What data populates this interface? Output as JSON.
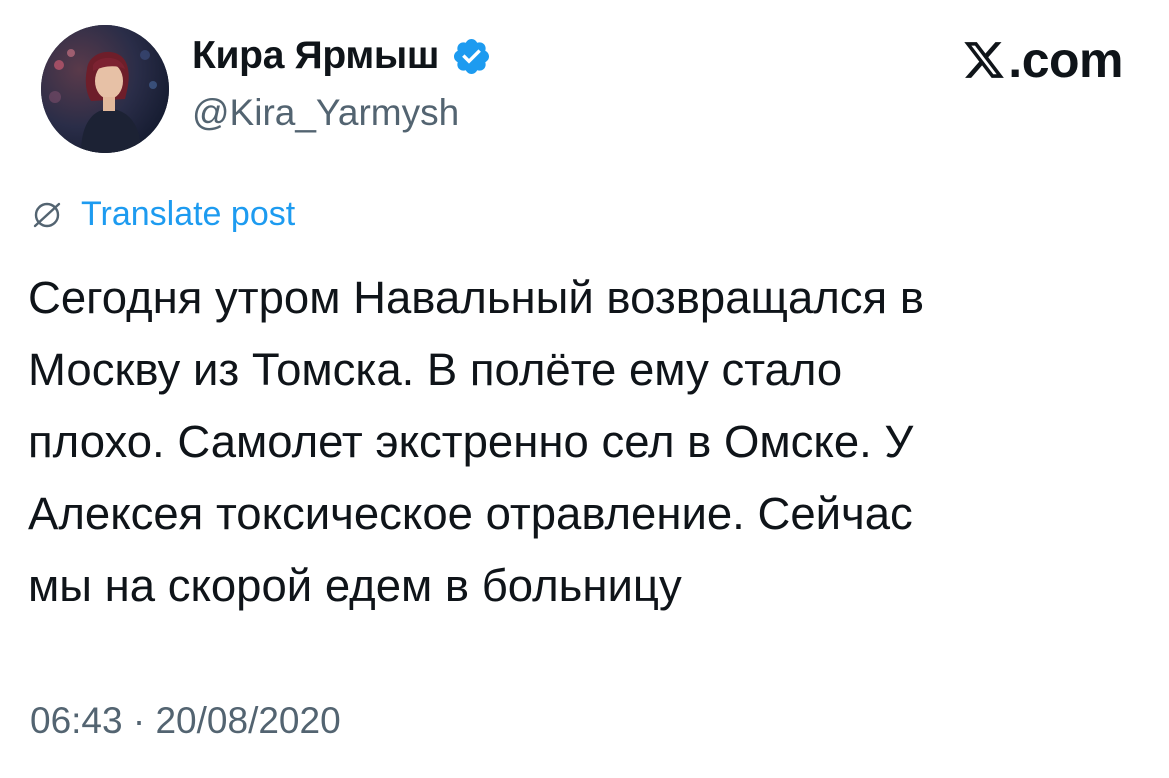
{
  "brand": {
    "text": ".com",
    "icon": "x-logo-icon"
  },
  "author": {
    "display_name": "Кира Ярмыш",
    "handle": "@Kira_Yarmysh",
    "verified": true,
    "verified_color": "#1d9bf0",
    "avatar_icon": "avatar-photo"
  },
  "translate": {
    "label": "Translate post",
    "icon": "globe-icon",
    "color": "#1d9bf0"
  },
  "tweet": {
    "lines": [
      "Сегодня утром Навальный возвращался в",
      "Москву из Томска. В полёте ему стало",
      "плохо. Самолет экстренно сел в Омске. У",
      "Алексея токсическое отравление. Сейчас",
      "мы на скорой едем в больницу"
    ]
  },
  "meta": {
    "time": "06:43",
    "separator": "·",
    "date": "20/08/2020"
  }
}
